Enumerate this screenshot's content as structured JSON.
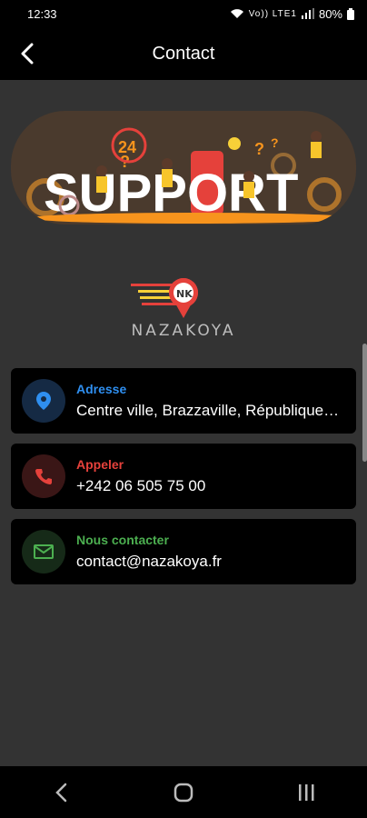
{
  "status_bar": {
    "time": "12:33",
    "network_label": "Vo)) LTE1",
    "battery": "80%"
  },
  "app_bar": {
    "title": "Contact",
    "back_icon": "arrow-left-icon"
  },
  "banner": {
    "text": "SUPPORT",
    "badge": "24",
    "accent_color": "#f7941d"
  },
  "logo": {
    "name": "NAZAKOYA",
    "color": "#e53935"
  },
  "contacts": [
    {
      "label": "Adresse",
      "value": "Centre ville, Brazzaville, République du Congo",
      "icon": "location-pin-icon",
      "color": "#2f8ff0"
    },
    {
      "label": "Appeler",
      "value": "+242 06 505 75 00",
      "icon": "phone-icon",
      "color": "#e5413b"
    },
    {
      "label": "Nous contacter",
      "value": "contact@nazakoya.fr",
      "icon": "mail-icon",
      "color": "#4caf50"
    }
  ],
  "nav": {
    "back_icon": "nav-back-icon",
    "home_icon": "nav-home-icon",
    "recents_icon": "nav-recents-icon"
  }
}
